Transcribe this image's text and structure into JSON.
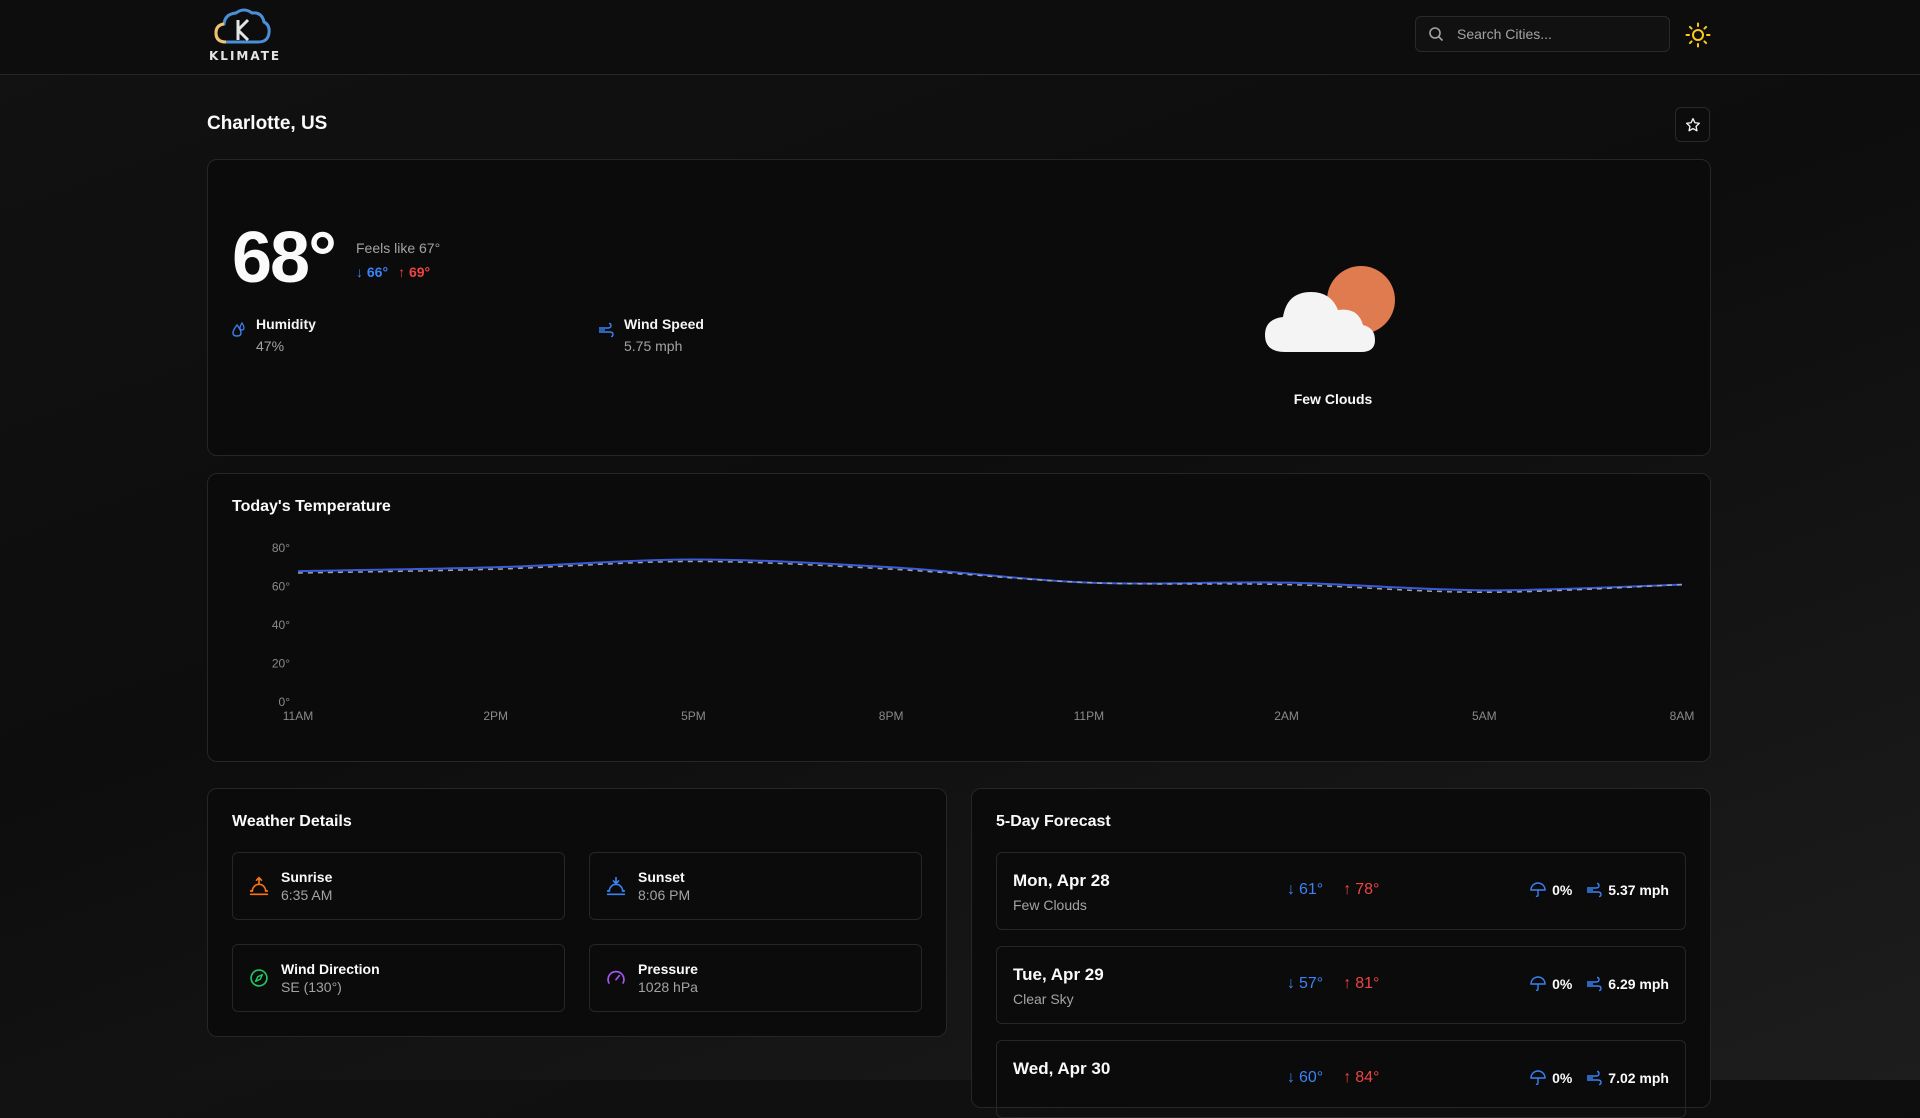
{
  "app": {
    "name": "KLIMATE"
  },
  "search": {
    "placeholder": "Search Cities..."
  },
  "location": {
    "title": "Charlotte, US"
  },
  "current": {
    "temp": "68°",
    "feels_like": "Feels like 67°",
    "min": "66°",
    "max": "69°",
    "humidity_label": "Humidity",
    "humidity_value": "47%",
    "wind_label": "Wind Speed",
    "wind_value": "5.75 mph",
    "description": "Few Clouds"
  },
  "chart_data": {
    "type": "line",
    "title": "Today's Temperature",
    "x": [
      "11AM",
      "2PM",
      "5PM",
      "8PM",
      "11PM",
      "2AM",
      "5AM",
      "8AM"
    ],
    "yticks": [
      "80°",
      "60°",
      "40°",
      "20°",
      "0°"
    ],
    "ylim": [
      0,
      80
    ],
    "series": [
      {
        "values": [
          68,
          70,
          74,
          70,
          62,
          62,
          58,
          61
        ],
        "style": "solid",
        "color": "#3b5bdb"
      },
      {
        "values": [
          67,
          69,
          73,
          69,
          62,
          61,
          57,
          61
        ],
        "style": "dashed",
        "color": "#9ca3af"
      }
    ]
  },
  "details": {
    "title": "Weather Details",
    "items": [
      {
        "label": "Sunrise",
        "value": "6:35 AM",
        "icon": "sunrise-icon",
        "color": "#f97316"
      },
      {
        "label": "Sunset",
        "value": "8:06 PM",
        "icon": "sunset-icon",
        "color": "#3b82f6"
      },
      {
        "label": "Wind Direction",
        "value": "SE (130°)",
        "icon": "compass-icon",
        "color": "#22c55e"
      },
      {
        "label": "Pressure",
        "value": "1028 hPa",
        "icon": "gauge-icon",
        "color": "#a855f7"
      }
    ]
  },
  "forecast": {
    "title": "5-Day Forecast",
    "days": [
      {
        "date": "Mon, Apr 28",
        "cond": "Few Clouds",
        "min": "61°",
        "max": "78°",
        "rain": "0%",
        "wind": "5.37 mph"
      },
      {
        "date": "Tue, Apr 29",
        "cond": "Clear Sky",
        "min": "57°",
        "max": "81°",
        "rain": "0%",
        "wind": "6.29 mph"
      },
      {
        "date": "Wed, Apr 30",
        "cond": "",
        "min": "60°",
        "max": "84°",
        "rain": "0%",
        "wind": "7.02 mph"
      }
    ]
  }
}
